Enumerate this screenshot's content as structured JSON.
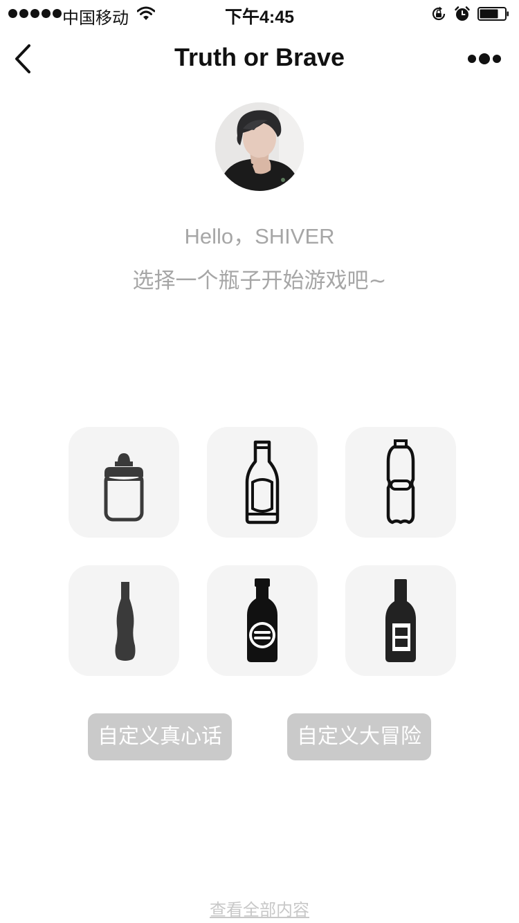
{
  "status_bar": {
    "carrier": "中国移动",
    "time": "下午4:45",
    "signal_icon": "signal-dots-icon",
    "wifi_icon": "wifi-icon",
    "orientation_lock_icon": "orientation-lock-icon",
    "alarm_icon": "alarm-icon",
    "battery_icon": "battery-icon"
  },
  "nav": {
    "title": "Truth or Brave",
    "back_icon": "chevron-left-icon",
    "more_icon": "more-dots-icon"
  },
  "profile": {
    "greeting": "Hello，SHIVER",
    "prompt": "选择一个瓶子开始游戏吧~"
  },
  "bottles": [
    {
      "icon": "baby-bottle-icon"
    },
    {
      "icon": "beer-bottle-icon"
    },
    {
      "icon": "water-bottle-icon"
    },
    {
      "icon": "cola-bottle-icon"
    },
    {
      "icon": "whiskey-bottle-icon"
    },
    {
      "icon": "wine-bottle-icon"
    }
  ],
  "actions": {
    "custom_truth": "自定义真心话",
    "custom_dare": "自定义大冒险"
  },
  "footer": {
    "view_all": "查看全部内容"
  },
  "colors": {
    "card_bg": "#f4f4f4",
    "button_bg": "#cacaca",
    "muted_text": "#a6a6a6",
    "icon_dark": "#3a3a3a"
  }
}
